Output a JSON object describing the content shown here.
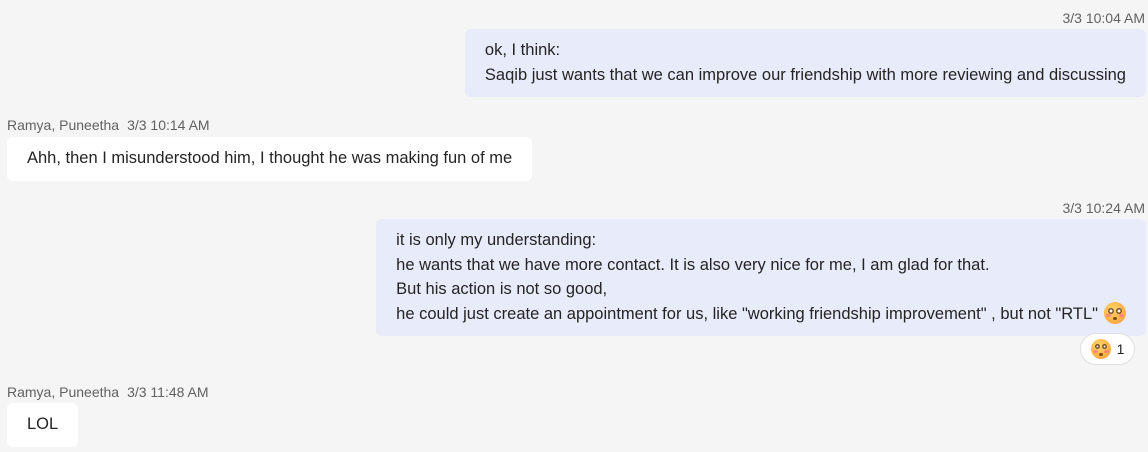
{
  "messages": [
    {
      "own": true,
      "timestamp": "3/3 10:04 AM",
      "lines": [
        "ok, I think:",
        "Saqib just wants that we can improve our friendship with more reviewing and discussing"
      ]
    },
    {
      "own": false,
      "sender": "Ramya, Puneetha",
      "timestamp": "3/3 10:14 AM",
      "lines": [
        "Ahh, then I misunderstood him, I thought he was making fun of me"
      ]
    },
    {
      "own": true,
      "timestamp": "3/3 10:24 AM",
      "lines": [
        "it is only my understanding:",
        "he wants that we have more contact. It is also very nice for me, I am glad for that.",
        "But his action is not so good,",
        "he could just create an appointment for us, like \"working friendship improvement\" , but not \"RTL\""
      ],
      "inline_emoji": "flushed-face",
      "reaction": {
        "emoji": "flushed-face",
        "count": "1"
      }
    },
    {
      "own": false,
      "sender": "Ramya, Puneetha",
      "timestamp": "3/3 11:48 AM",
      "lines": [
        "LOL"
      ]
    }
  ],
  "colors": {
    "background": "#f5f5f5",
    "own_bubble": "#e8ebfa",
    "other_bubble": "#ffffff",
    "meta_text": "#616161"
  }
}
